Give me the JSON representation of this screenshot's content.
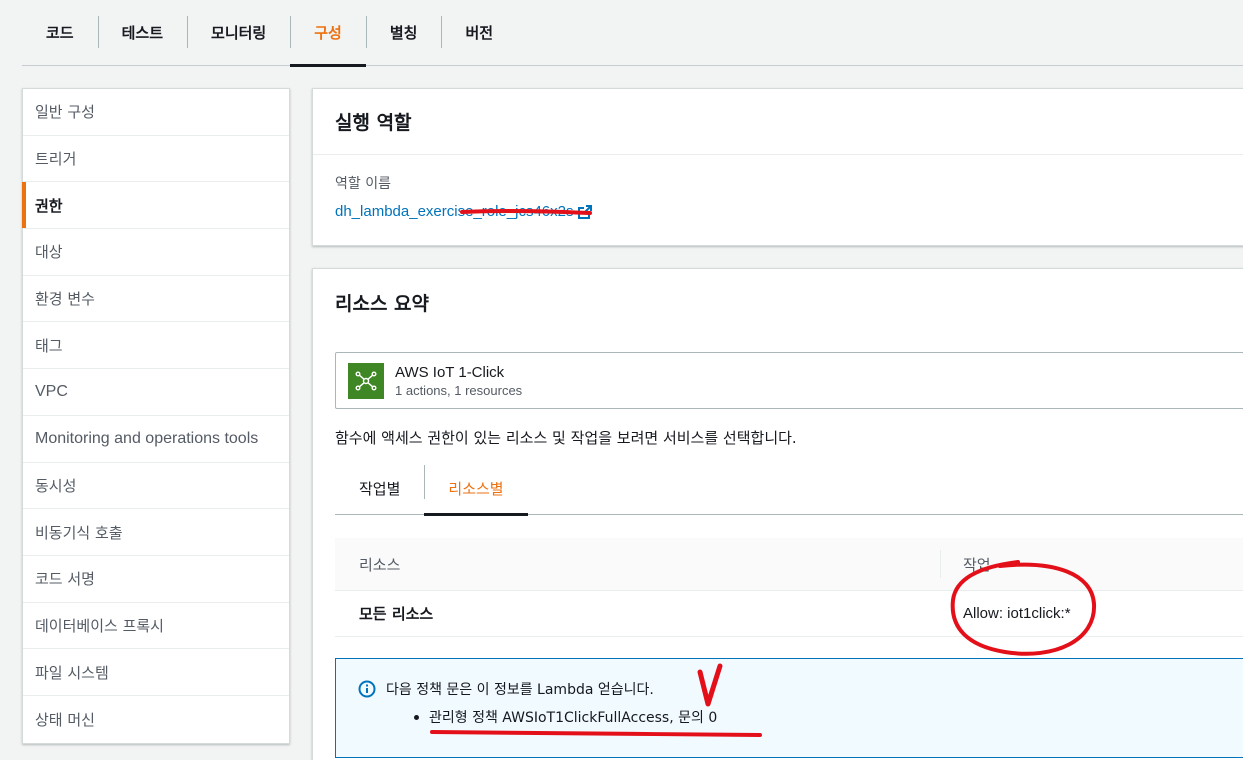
{
  "top_tabs": [
    "코드",
    "테스트",
    "모니터링",
    "구성",
    "별칭",
    "버전"
  ],
  "side_nav": [
    "일반 구성",
    "트리거",
    "권한",
    "대상",
    "환경 변수",
    "태그",
    "VPC",
    "Monitoring and operations tools",
    "동시성",
    "비동기식 호출",
    "코드 서명",
    "데이터베이스 프록시",
    "파일 시스템",
    "상태 머신"
  ],
  "role_panel": {
    "title": "실행 역할",
    "label": "역할 이름",
    "role_name": "dh_lambda_exercise_role_jcs46x2s"
  },
  "resource_panel": {
    "title": "리소스 요약",
    "service": {
      "name": "AWS IoT 1-Click",
      "summary": "1 actions, 1 resources"
    },
    "description": "함수에 액세스 권한이 있는 리소스 및 작업을 보려면 서비스를 선택합니다.",
    "tabs": [
      "작업별",
      "리소스별"
    ],
    "table": {
      "headers": [
        "리소스",
        "작업"
      ],
      "rows": [
        {
          "resource": "모든 리소스",
          "action": "Allow: iot1click:*"
        }
      ]
    },
    "info": {
      "message": "다음 정책 문은 이 정보를 Lambda 얻습니다.",
      "bullet": "관리형 정책 AWSIoT1ClickFullAccess, 문의 0"
    }
  },
  "colors": {
    "accent": "#ec7211",
    "link": "#0073bb",
    "service_icon_bg": "#3f8624",
    "annotation": "#e3101a"
  }
}
